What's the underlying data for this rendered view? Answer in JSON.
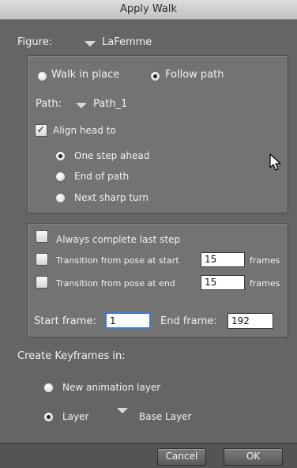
{
  "window": {
    "title": "Apply Walk"
  },
  "figure": {
    "label": "Figure:",
    "value": "LaFemme"
  },
  "path_panel": {
    "walk_in_place": "Walk in place",
    "follow_path": "Follow path",
    "path_label": "Path:",
    "path_value": "Path_1",
    "align_head": "Align head to",
    "one_step_ahead": "One step ahead",
    "end_of_path": "End of path",
    "next_sharp_turn": "Next sharp turn"
  },
  "options_panel": {
    "always_complete": "Always complete last step",
    "transition_start": "Transition from pose at start",
    "transition_start_value": "15",
    "transition_end": "Transition from pose at end",
    "transition_end_value": "15",
    "frames_unit": "frames",
    "start_frame_label": "Start frame:",
    "start_frame_value": "1",
    "end_frame_label": "End frame:",
    "end_frame_value": "192"
  },
  "keyframes": {
    "heading": "Create Keyframes in:",
    "new_animation_layer": "New animation layer",
    "layer": "Layer",
    "layer_value": "Base Layer"
  },
  "buttons": {
    "cancel": "Cancel",
    "ok": "OK"
  },
  "icons": {
    "dropdown": "triangle-down-icon",
    "cursor": "mouse-pointer-icon"
  }
}
